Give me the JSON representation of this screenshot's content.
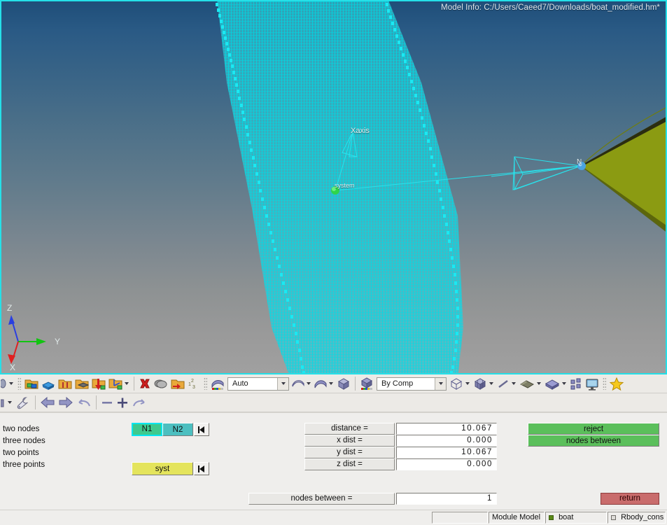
{
  "viewport": {
    "model_info": "Model Info: C:/Users/Caeed7/Downloads/boat_modified.hm*",
    "xaxis_label": "Xaxis",
    "origin_label": "system",
    "node_label": "N",
    "axis_z": "Z",
    "axis_y": "Y",
    "axis_x": "X",
    "colors": {
      "background_top": "#1f4e79",
      "background_bottom": "#a0a0a0",
      "mesh": "#2fc0d0",
      "mesh_edge": "#1ce8f2",
      "selected_surface": "#8b9b12",
      "highlight_node": "#31d14a",
      "target_node": "#4aa3e0",
      "viewport_border": "#25e0e8"
    }
  },
  "toolbar_top": {
    "icons": [
      {
        "name": "collector-icon",
        "label": "Collectors"
      },
      {
        "name": "component-icon",
        "label": "Component"
      },
      {
        "name": "assembly-icon",
        "label": "Assembly"
      },
      {
        "name": "include-icon",
        "label": "Include"
      },
      {
        "name": "load-collector-icon",
        "label": "Load Collector"
      },
      {
        "name": "system-collector-icon",
        "label": "System Collector"
      },
      {
        "name": "delete-icon",
        "label": "Delete"
      },
      {
        "name": "mask-icon",
        "label": "Mask"
      },
      {
        "name": "organize-icon",
        "label": "Organize"
      },
      {
        "name": "renumber-icon",
        "label": "Renumber"
      }
    ],
    "visualization_mode": "Auto",
    "color_mode": "By Comp",
    "right_icons": [
      {
        "name": "wireframe-cube-icon",
        "label": "Wireframe"
      },
      {
        "name": "solid-cube-icon",
        "label": "Shaded"
      },
      {
        "name": "line-icon",
        "label": "Lines"
      },
      {
        "name": "surface-icon",
        "label": "Surfaces"
      },
      {
        "name": "solid-slab-icon",
        "label": "Solids"
      },
      {
        "name": "elements-icon",
        "label": "Elements"
      },
      {
        "name": "monitor-icon",
        "label": "Display"
      },
      {
        "name": "star-icon",
        "label": "Favorites"
      }
    ]
  },
  "toolbar_second": {
    "icons": [
      {
        "name": "wrench-icon",
        "label": "Options"
      },
      {
        "name": "back-arrow-icon",
        "label": "Back"
      },
      {
        "name": "forward-arrow-icon",
        "label": "Forward"
      },
      {
        "name": "undo-icon",
        "label": "Undo"
      },
      {
        "name": "zoom-out-icon",
        "label": "Zoom Out"
      },
      {
        "name": "zoom-in-icon",
        "label": "Zoom In"
      },
      {
        "name": "redo-icon",
        "label": "Redo"
      }
    ]
  },
  "panel": {
    "options": [
      {
        "label": "two nodes",
        "selected": true
      },
      {
        "label": "three nodes",
        "selected": false
      },
      {
        "label": "two points",
        "selected": false
      },
      {
        "label": "three points",
        "selected": false
      }
    ],
    "node_selectors": [
      {
        "label": "N1",
        "state": "active"
      },
      {
        "label": "N2",
        "state": "set"
      }
    ],
    "node_step_icon": "step-back-icon",
    "system_button": {
      "label": "syst"
    },
    "system_step_icon": "step-back-icon",
    "measurements": [
      {
        "label": "distance =",
        "value": "10.067"
      },
      {
        "label": "x dist  =",
        "value": "0.000"
      },
      {
        "label": "y dist  =",
        "value": "10.067"
      },
      {
        "label": "z dist  =",
        "value": "0.000"
      }
    ],
    "actions": [
      {
        "label": "reject"
      },
      {
        "label": "nodes  between"
      }
    ],
    "nodes_between": {
      "label": "nodes between  =",
      "value": "1"
    },
    "return_button": {
      "label": "return"
    }
  },
  "statusbar": {
    "message": "",
    "module": "Module Model",
    "component": "boat",
    "collector": "Rbody_cons"
  }
}
